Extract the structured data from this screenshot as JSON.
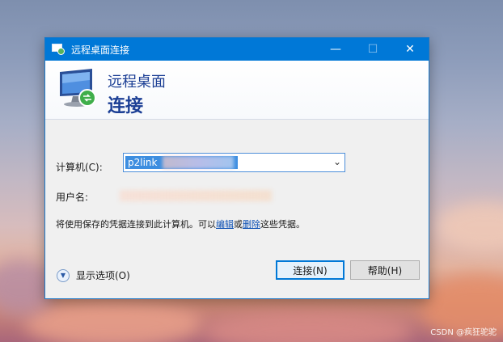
{
  "window": {
    "title": "远程桌面连接",
    "controls": {
      "minimize": "—",
      "maximize": "☐",
      "close": "✕"
    }
  },
  "banner": {
    "line1": "远程桌面",
    "line2": "连接"
  },
  "form": {
    "computer_label": "计算机(C):",
    "computer_value": "p2link",
    "username_label": "用户名:",
    "info_prefix": "将使用保存的凭据连接到此计算机。可以",
    "info_edit_link": "编辑",
    "info_or": "或",
    "info_delete_link": "删除",
    "info_suffix": "这些凭据。"
  },
  "footer": {
    "options_label": "显示选项(O)",
    "connect_button": "连接(N)",
    "help_button": "帮助(H)"
  },
  "watermark": "CSDN @疯狂驼驼",
  "icons": {
    "app": "remote-desktop-icon",
    "logo": "remote-desktop-monitor-icon",
    "dropdown": "chevron-down-icon",
    "options": "chevron-down-circle-icon"
  },
  "colors": {
    "titlebar": "#0078d7",
    "banner_text": "#1c3f95",
    "link": "#0b4fb3",
    "selection": "#3d8ee0"
  }
}
